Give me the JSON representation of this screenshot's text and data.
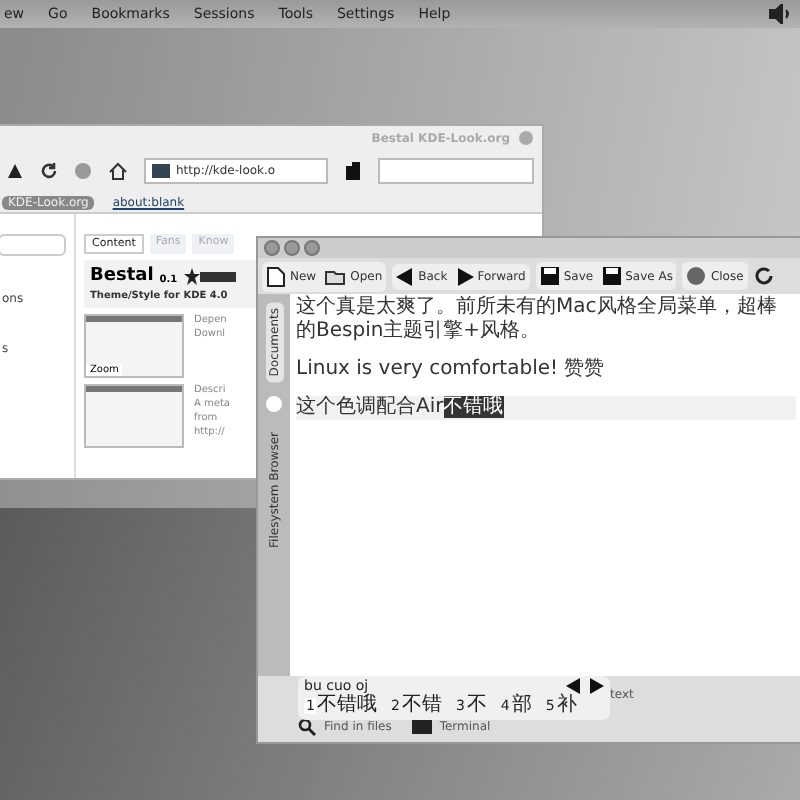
{
  "menu_bar": {
    "items": [
      "ew",
      "Go",
      "Bookmarks",
      "Sessions",
      "Tools",
      "Settings",
      "Help"
    ]
  },
  "browser": {
    "title": "Bestal KDE-Look.org",
    "url": "http://kde-look.o",
    "tabs": [
      {
        "label": "KDE-Look.org",
        "selected": true
      },
      {
        "label": "about:blank",
        "selected": false
      }
    ],
    "sidebar_items": [
      "ons",
      "s"
    ],
    "content_tabs": [
      {
        "label": "Content",
        "selected": true
      },
      {
        "label": "Fans",
        "selected": false
      },
      {
        "label": "Know",
        "selected": false
      }
    ],
    "heading": "Bestal",
    "version": "0.1",
    "subtitle": "Theme/Style for KDE 4.0",
    "zoom": "Zoom",
    "entries": [
      {
        "lines": [
          "Depen",
          "Downl"
        ]
      },
      {
        "lines": [
          "Descri",
          "A meta",
          "from",
          "http://"
        ]
      }
    ]
  },
  "editor": {
    "toolbar": [
      "New",
      "Open",
      "Back",
      "Forward",
      "Save",
      "Save As",
      "Close"
    ],
    "side_tabs": [
      {
        "label": "Documents",
        "selected": true
      },
      {
        "label": "Filesystem Browser",
        "selected": false
      }
    ],
    "lines": [
      {
        "text": "这个真是太爽了。前所未有的Mac风格全局菜单，超棒的Bespin主题引擎+风格。",
        "current": false
      },
      {
        "text": "Linux is very comfortable! 赞赞",
        "current": false
      },
      {
        "text": "这个色调配合Air",
        "selection": "不错哦",
        "current": true
      }
    ],
    "status_text": "text",
    "bottom_tabs": [
      "Find in files",
      "Terminal"
    ]
  },
  "ime": {
    "preedit": "bu cuo oj",
    "candidates": [
      {
        "index": "1",
        "text": "不错哦",
        "selected": true
      },
      {
        "index": "2",
        "text": "不错",
        "selected": false
      },
      {
        "index": "3",
        "text": "不",
        "selected": false
      },
      {
        "index": "4",
        "text": "部",
        "selected": false
      },
      {
        "index": "5",
        "text": "补",
        "selected": false
      }
    ]
  }
}
